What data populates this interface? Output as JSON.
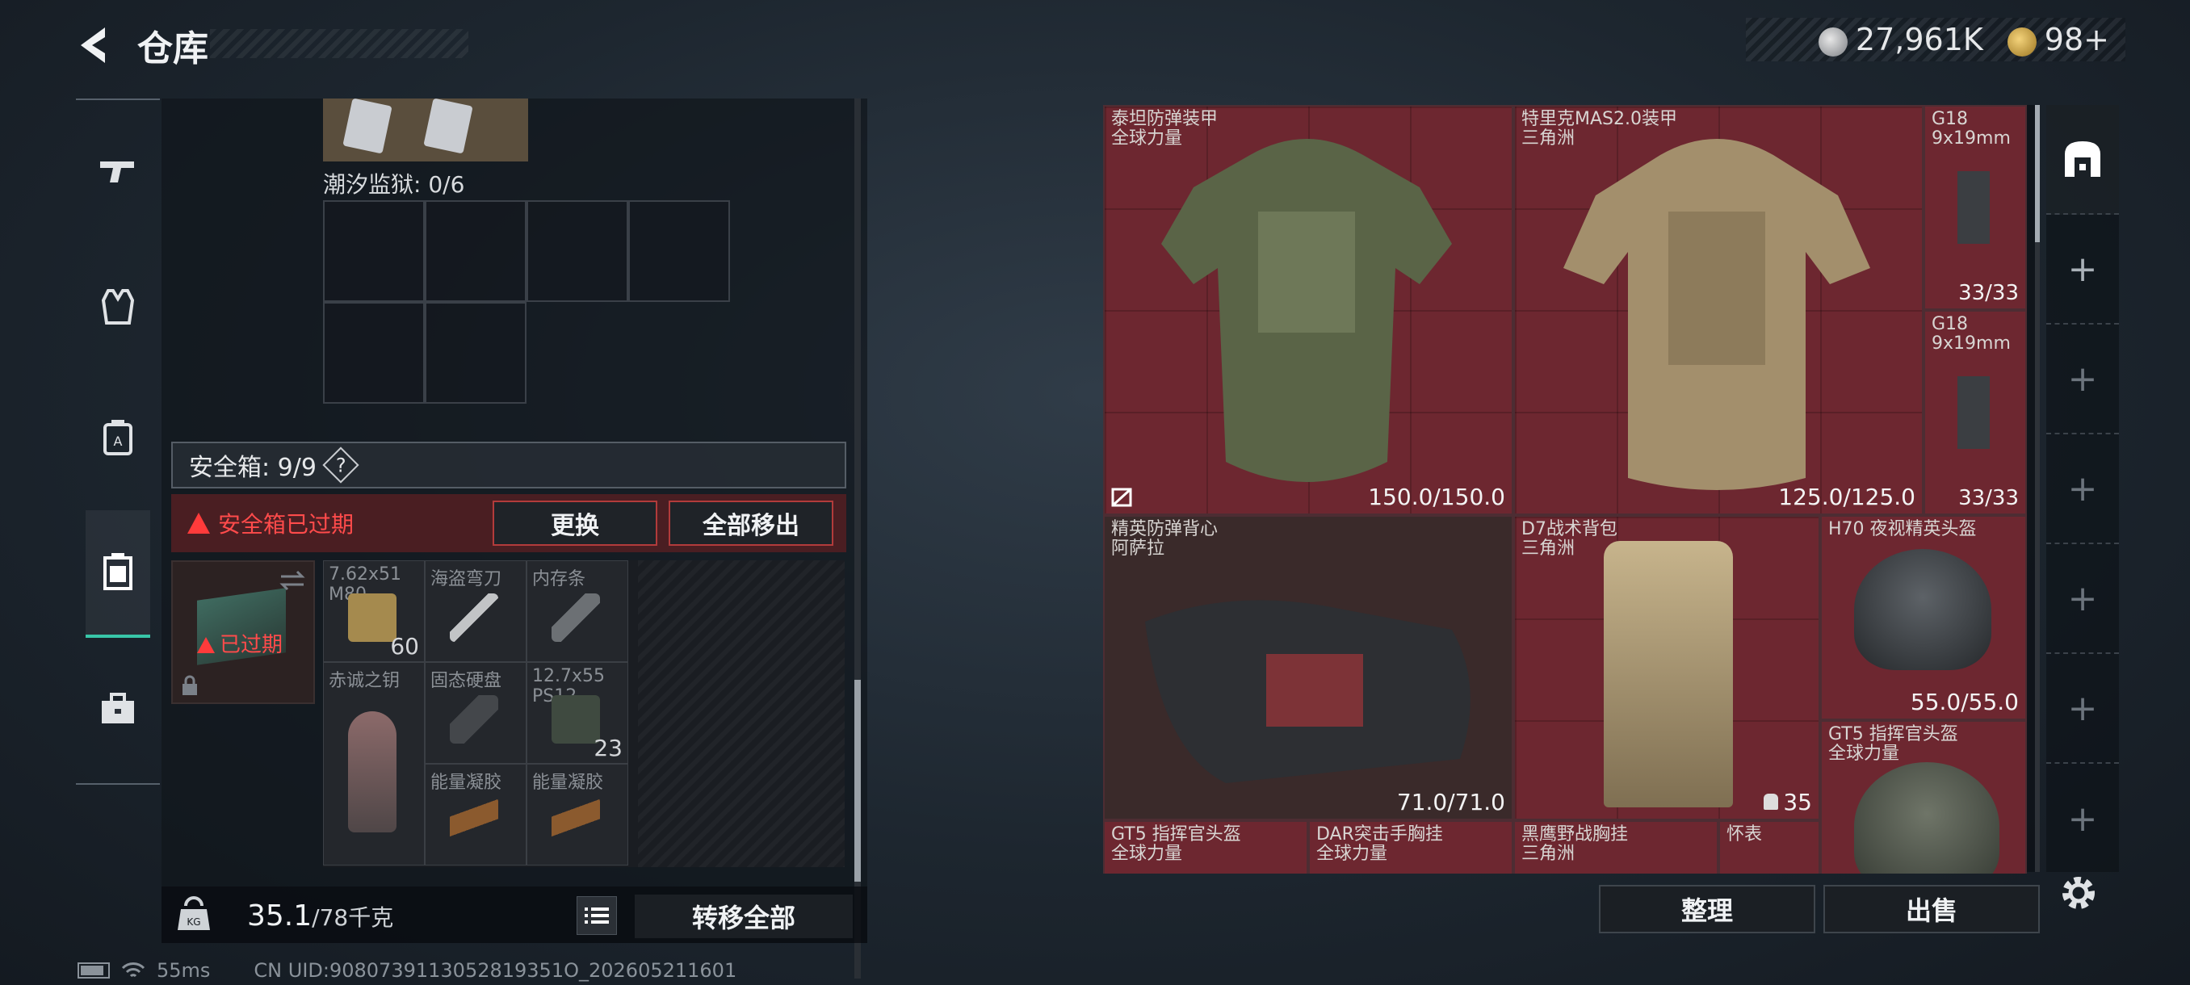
{
  "header": {
    "title": "仓库"
  },
  "currency": {
    "silver": "27,961K",
    "gold": "98+"
  },
  "rail": {
    "items": [
      "weapon-icon",
      "armor-icon",
      "backpack-icon",
      "safebox-icon",
      "toolbox-icon"
    ]
  },
  "left": {
    "prison_label": "潮汐监狱: 0/6",
    "safebox_label": "安全箱: 9/9",
    "help": "?",
    "expired_notice": "安全箱已过期",
    "replace_btn": "更换",
    "move_all_btn": "全部移出",
    "case_expired": "已过期",
    "items": [
      {
        "name": "7.62x51 M80",
        "count": "60"
      },
      {
        "name": "海盗弯刀",
        "count": ""
      },
      {
        "name": "内存条",
        "count": ""
      },
      {
        "name": "赤诚之钥",
        "count": ""
      },
      {
        "name": "固态硬盘",
        "count": ""
      },
      {
        "name": "12.7x55 PS12",
        "count": "23"
      },
      {
        "name": "能量凝胶",
        "count": ""
      },
      {
        "name": "能量凝胶",
        "count": ""
      }
    ],
    "weight_value": "35.1",
    "weight_unit": "/78千克",
    "transfer_btn": "转移全部"
  },
  "status": {
    "ping": "55ms",
    "uid": "CN UID:9080739113052819351O_202605211601"
  },
  "stash": {
    "slots": [
      {
        "name": "泰坦防弹装甲",
        "sub": "全球力量",
        "durability": "150.0/150.0"
      },
      {
        "name": "特里克MAS2.0装甲",
        "sub": "三角洲",
        "durability": "125.0/125.0"
      },
      {
        "name": "G18",
        "sub": "9x19mm",
        "durability": "33/33"
      },
      {
        "name": "G18",
        "sub": "9x19mm",
        "durability": "33/33"
      },
      {
        "name": "精英防弹背心",
        "sub": "阿萨拉",
        "durability": "71.0/71.0"
      },
      {
        "name": "D7战术背包",
        "sub": "三角洲",
        "durability": "35"
      },
      {
        "name": "H70 夜视精英头盔",
        "sub": "",
        "durability": "55.0/55.0"
      },
      {
        "name": "GT5 指挥官头盔",
        "sub": "全球力量",
        "durability": ""
      },
      {
        "name": "GT5 指挥官头盔",
        "sub": "全球力量",
        "durability": ""
      },
      {
        "name": "DAR突击手胸挂",
        "sub": "全球力量",
        "durability": ""
      },
      {
        "name": "黑鹰野战胸挂",
        "sub": "三角洲",
        "durability": ""
      },
      {
        "name": "怀表",
        "sub": "",
        "durability": ""
      }
    ],
    "tidy_btn": "整理",
    "sell_btn": "出售"
  },
  "right_rail": {
    "add": "+"
  }
}
